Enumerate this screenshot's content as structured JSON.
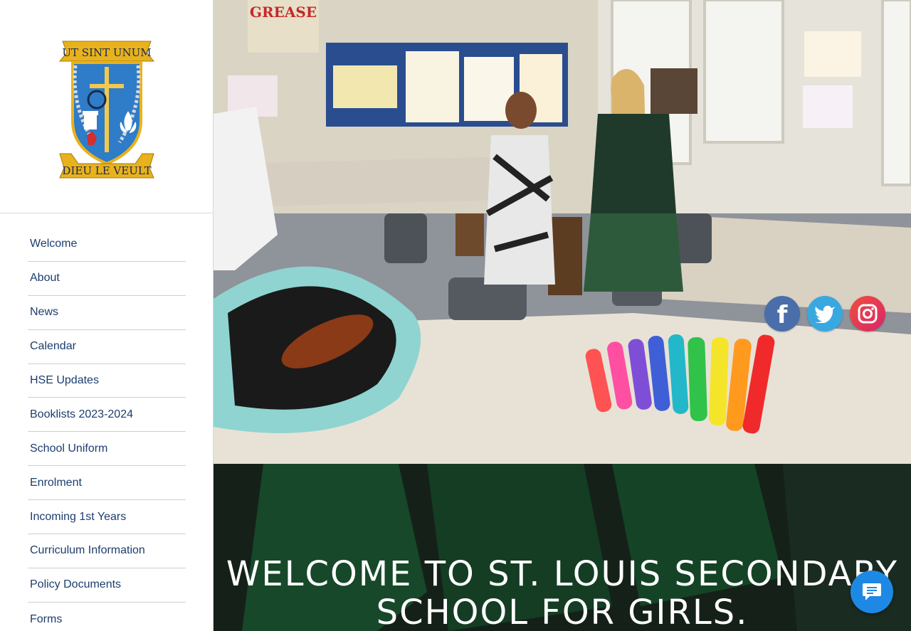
{
  "logo": {
    "motto_top": "UT SINT UNUM",
    "motto_bottom": "DIEU LE VEULT"
  },
  "sidebar": {
    "items": [
      {
        "label": "Welcome"
      },
      {
        "label": "About"
      },
      {
        "label": "News"
      },
      {
        "label": "Calendar"
      },
      {
        "label": "HSE Updates"
      },
      {
        "label": "Booklists 2023-2024"
      },
      {
        "label": "School Uniform"
      },
      {
        "label": "Enrolment"
      },
      {
        "label": "Incoming 1st Years"
      },
      {
        "label": "Curriculum Information"
      },
      {
        "label": "Policy Documents"
      },
      {
        "label": "Forms"
      }
    ]
  },
  "social": {
    "facebook": {
      "icon": "facebook-icon",
      "glyph": "f"
    },
    "twitter": {
      "icon": "twitter-icon"
    },
    "instagram": {
      "icon": "instagram-icon"
    }
  },
  "welcome": {
    "title": "WELCOME TO ST. LOUIS SECONDARY SCHOOL FOR GIRLS."
  },
  "hero_poster": {
    "title": "GREASE"
  },
  "chat": {
    "icon": "chat-icon"
  },
  "colors": {
    "nav_text": "#1c3d6e",
    "crest_blue": "#2f7cc8",
    "crest_gold": "#e8b21c",
    "chat_blue": "#1e88e5",
    "facebook": "#4a6ea9",
    "twitter": "#3aa8e0"
  }
}
